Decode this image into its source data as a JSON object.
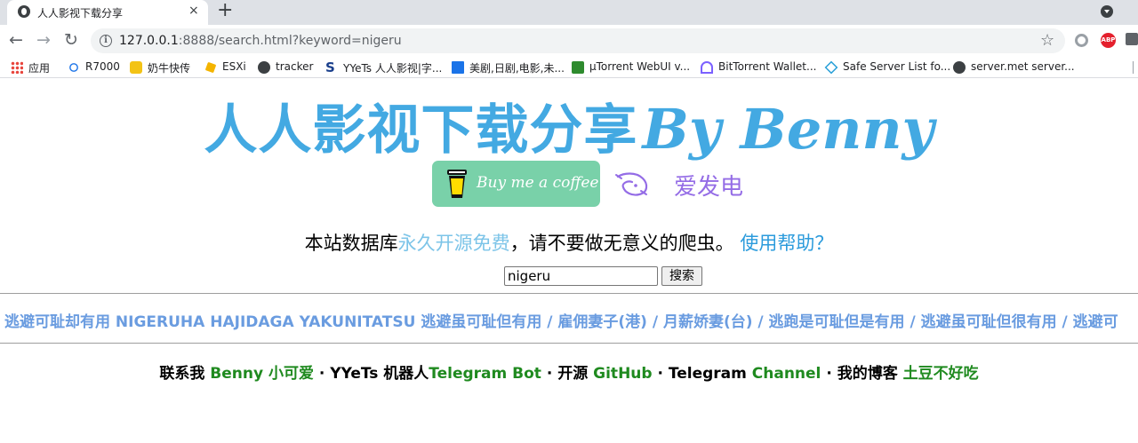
{
  "browser": {
    "tab_title": "人人影视下载分享",
    "tab_close": "×",
    "new_tab": "+",
    "url_host": "127.0.0.1",
    "url_rest": ":8888/search.html?keyword=nigeru",
    "icons": [
      "back-icon",
      "forward-icon",
      "reload-icon",
      "info-icon",
      "star-icon",
      "extension-icon",
      "adblock-icon",
      "puzzle-icon"
    ]
  },
  "bookmarks": [
    {
      "label": "应用",
      "icon": "apps-grid-icon"
    },
    {
      "label": "R7000",
      "icon": "router-icon"
    },
    {
      "label": "奶牛快传",
      "icon": "cow-icon"
    },
    {
      "label": "ESXi",
      "icon": "esxi-icon"
    },
    {
      "label": "tracker",
      "icon": "globe-icon"
    },
    {
      "label": "YYeTs 人人影视|字...",
      "icon": "s-icon"
    },
    {
      "label": "美剧,日剧,电影,未...",
      "icon": "chart-icon"
    },
    {
      "label": "µTorrent WebUI v...",
      "icon": "utorrent-icon"
    },
    {
      "label": "BitTorrent Wallet...",
      "icon": "bittorrent-icon"
    },
    {
      "label": "Safe Server List fo...",
      "icon": "diamond-icon"
    },
    {
      "label": "server.met server...",
      "icon": "globe-icon"
    }
  ],
  "hero": {
    "title_cn": "人人影视下载分享",
    "title_en": "By Benny"
  },
  "donate": {
    "coffee_label": "Buy me a coffee",
    "afdian_label": "爱发电"
  },
  "notice": {
    "prefix": "本站数据库",
    "highlight": "永久开源免费",
    "suffix": "，请不要做无意义的爬虫。 ",
    "help": "使用帮助？"
  },
  "search": {
    "value": "nigeru",
    "button": "搜索"
  },
  "marquee": "逃避可耻却有用 NIGERUHA HAJIDAGA YAKUNITATSU 逃避虽可耻但有用 / 雇佣妻子(港) / 月薪娇妻(台) / 逃跑是可耻但是有用 / 逃避虽可耻但很有用 / 逃避可",
  "footer": {
    "contact": "联系我",
    "contact_link": "Benny 小可爱",
    "bot": "YYeTs 机器人",
    "bot_link": "Telegram Bot",
    "source": "开源",
    "source_link": "GitHub",
    "channel": "Telegram",
    "channel_link": "Channel",
    "blog": "我的博客",
    "blog_link": "土豆不好吃",
    "separator": "·"
  },
  "colors": {
    "title": "#43a9e2",
    "coffee_bg": "#79d1a9",
    "afdian": "#946ce6",
    "marquee": "#6a9ce0",
    "footer_link": "#1f8a1f"
  }
}
